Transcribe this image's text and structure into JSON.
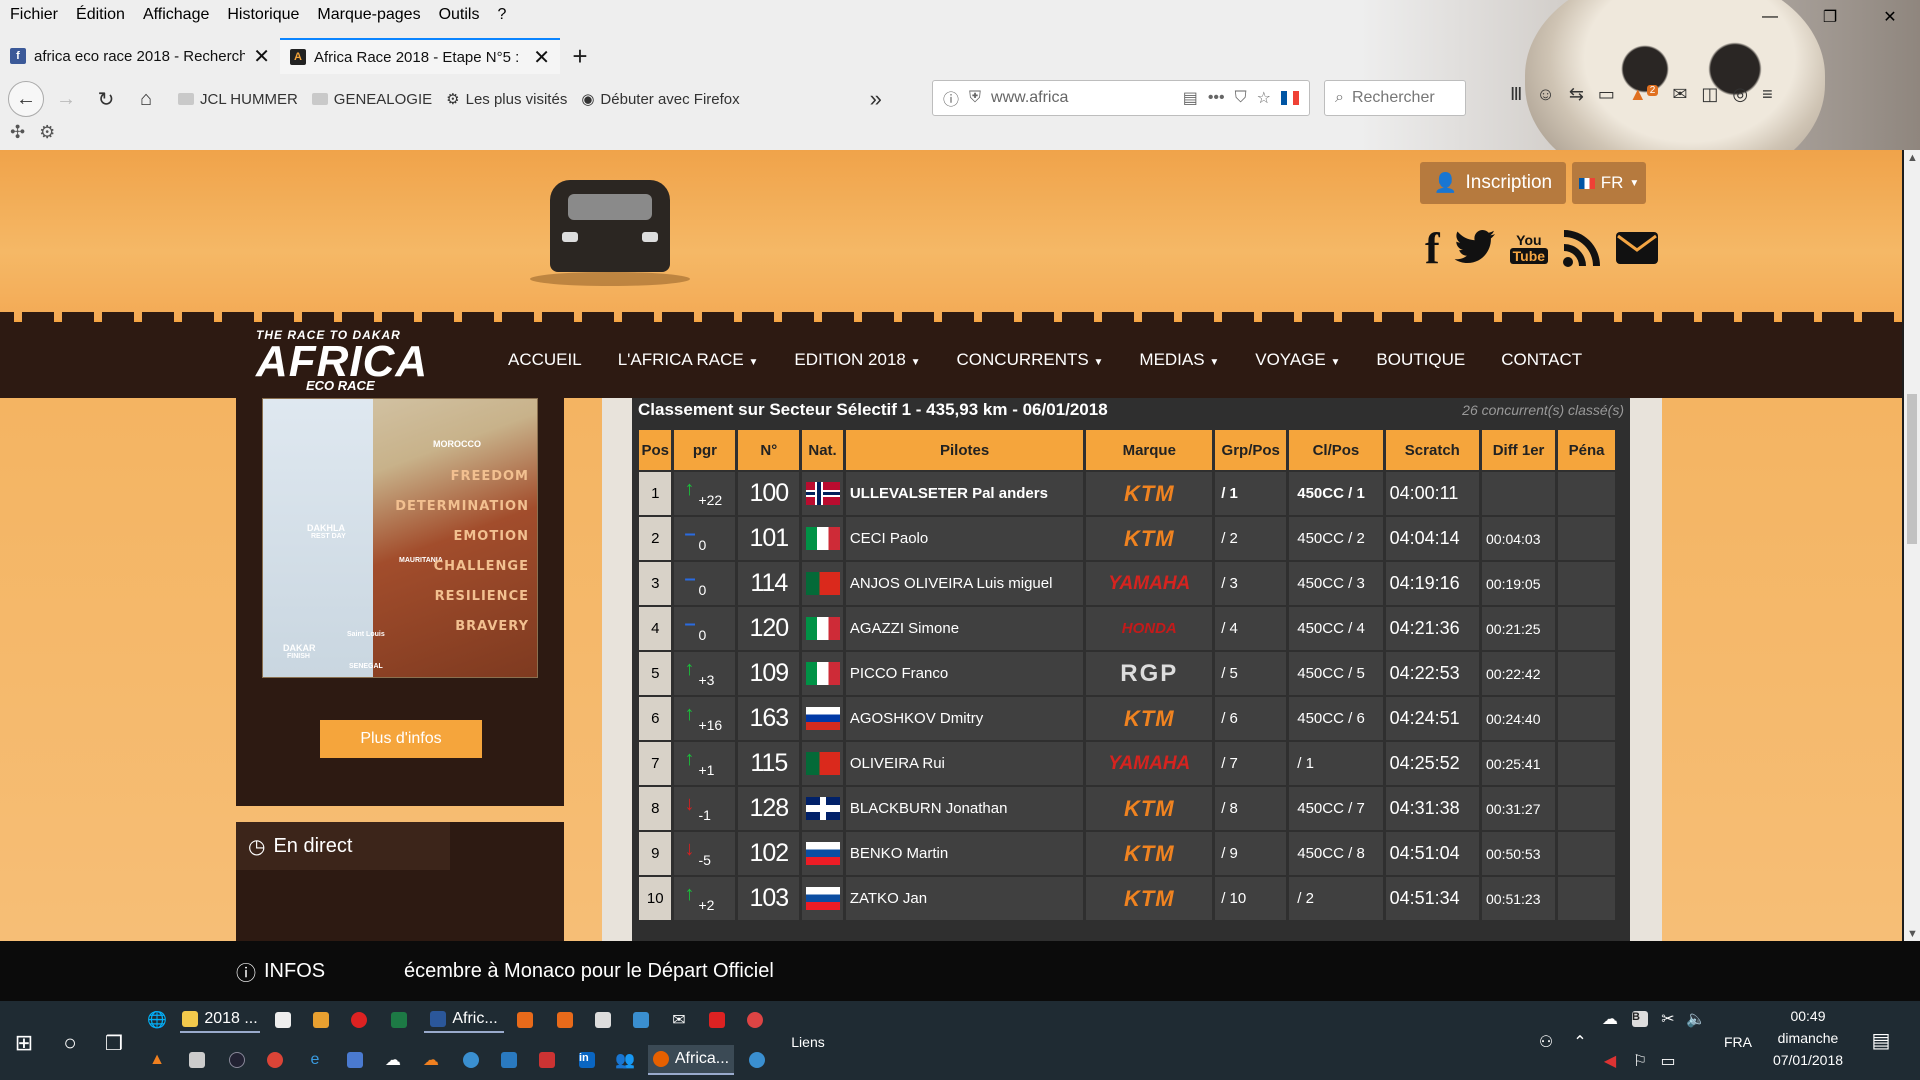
{
  "browser": {
    "menu": [
      "Fichier",
      "Édition",
      "Affichage",
      "Historique",
      "Marque-pages",
      "Outils",
      "?"
    ],
    "tabs": [
      {
        "title": "africa eco race 2018 - Recherch",
        "icon": "facebook-favicon"
      },
      {
        "title": "Africa Race 2018 - Etape N°5 : ",
        "icon": "africa-race-favicon"
      }
    ],
    "bookmarks": [
      "JCL HUMMER",
      "GENEALOGIE",
      "Les plus visités",
      "Débuter avec Firefox"
    ],
    "url": "www.africa",
    "search_placeholder": "Rechercher",
    "badge_count": "2"
  },
  "site": {
    "inscription": "Inscription",
    "lang": "FR",
    "logo": {
      "line1": "THE RACE TO DAKAR",
      "line2": "AFRICA",
      "line3": "ECO RACE"
    },
    "nav": [
      "ACCUEIL",
      "L'AFRICA RACE",
      "EDITION 2018",
      "CONCURRENTS",
      "MEDIAS",
      "VOYAGE",
      "BOUTIQUE",
      "CONTACT"
    ],
    "nav_dropdown": [
      false,
      true,
      true,
      true,
      true,
      true,
      false,
      false
    ],
    "map_words": [
      "FREEDOM",
      "DETERMINATION",
      "EMOTION",
      "CHALLENGE",
      "RESILIENCE",
      "BRAVERY"
    ],
    "map_labels": [
      "MOROCCO",
      "DAKHLA",
      "REST DAY",
      "MAURITANIA",
      "SENEGAL",
      "DAKAR",
      "FINISH",
      "Saint Louis"
    ],
    "plus_infos": "Plus d'infos",
    "en_direct": "En direct"
  },
  "classement": {
    "title": "Classement sur Secteur Sélectif 1 - 435,93 km - 06/01/2018",
    "count": "26 concurrent(s) classé(s)",
    "headers": [
      "Pos",
      "pgr",
      "N°",
      "Nat.",
      "Pilotes",
      "Marque",
      "Grp/Pos",
      "Cl/Pos",
      "Scratch",
      "Diff 1er",
      "Péna"
    ],
    "rows": [
      {
        "pos": "1",
        "dir": "up",
        "pgr": "+22",
        "num": "100",
        "nat": "NOR",
        "pilote": "ULLEVALSETER Pal anders",
        "marque": "KTM",
        "grp": "/ 1",
        "cl": "450CC / 1",
        "scratch": "04:00:11",
        "diff": "",
        "pena": ""
      },
      {
        "pos": "2",
        "dir": "eq",
        "pgr": "0",
        "num": "101",
        "nat": "ITA",
        "pilote": "CECI Paolo",
        "marque": "KTM",
        "grp": "/ 2",
        "cl": "450CC / 2",
        "scratch": "04:04:14",
        "diff": "00:04:03",
        "pena": ""
      },
      {
        "pos": "3",
        "dir": "eq",
        "pgr": "0",
        "num": "114",
        "nat": "POR",
        "pilote": "ANJOS OLIVEIRA Luis miguel",
        "marque": "YAMAHA",
        "grp": "/ 3",
        "cl": "450CC / 3",
        "scratch": "04:19:16",
        "diff": "00:19:05",
        "pena": ""
      },
      {
        "pos": "4",
        "dir": "eq",
        "pgr": "0",
        "num": "120",
        "nat": "ITA",
        "pilote": "AGAZZI Simone",
        "marque": "HONDA",
        "grp": "/ 4",
        "cl": "450CC / 4",
        "scratch": "04:21:36",
        "diff": "00:21:25",
        "pena": ""
      },
      {
        "pos": "5",
        "dir": "up",
        "pgr": "+3",
        "num": "109",
        "nat": "ITA",
        "pilote": "PICCO Franco",
        "marque": "RGP",
        "grp": "/ 5",
        "cl": "450CC / 5",
        "scratch": "04:22:53",
        "diff": "00:22:42",
        "pena": ""
      },
      {
        "pos": "6",
        "dir": "up",
        "pgr": "+16",
        "num": "163",
        "nat": "RUS",
        "pilote": "AGOSHKOV Dmitry",
        "marque": "KTM",
        "grp": "/ 6",
        "cl": "450CC / 6",
        "scratch": "04:24:51",
        "diff": "00:24:40",
        "pena": ""
      },
      {
        "pos": "7",
        "dir": "up",
        "pgr": "+1",
        "num": "115",
        "nat": "POR",
        "pilote": "OLIVEIRA Rui",
        "marque": "YAMAHA",
        "grp": "/ 7",
        "cl": "/ 1",
        "scratch": "04:25:52",
        "diff": "00:25:41",
        "pena": ""
      },
      {
        "pos": "8",
        "dir": "down",
        "pgr": "-1",
        "num": "128",
        "nat": "GBR",
        "pilote": "BLACKBURN Jonathan",
        "marque": "KTM",
        "grp": "/ 8",
        "cl": "450CC / 7",
        "scratch": "04:31:38",
        "diff": "00:31:27",
        "pena": ""
      },
      {
        "pos": "9",
        "dir": "down",
        "pgr": "-5",
        "num": "102",
        "nat": "SVK",
        "pilote": "BENKO Martin",
        "marque": "KTM",
        "grp": "/ 9",
        "cl": "450CC / 8",
        "scratch": "04:51:04",
        "diff": "00:50:53",
        "pena": ""
      },
      {
        "pos": "10",
        "dir": "up",
        "pgr": "+2",
        "num": "103",
        "nat": "SVK",
        "pilote": "ZATKO Jan",
        "marque": "KTM",
        "grp": "/ 10",
        "cl": "/ 2",
        "scratch": "04:51:34",
        "diff": "00:51:23",
        "pena": ""
      }
    ]
  },
  "infos": {
    "label": "INFOS",
    "ticker": "écembre à Monaco pour le Départ Officiel"
  },
  "taskbar": {
    "pinned1": "2018 ...",
    "pinned2": "Afric...",
    "pinned3": "Africa...",
    "liens": "Liens",
    "lang": "FRA",
    "time": "00:49",
    "day": "dimanche",
    "date": "07/01/2018"
  },
  "colors": {
    "accent": "#f5a53c",
    "dark": "#2d1a12",
    "up": "#19c23a",
    "down": "#d42020",
    "eq": "#2a6be0"
  }
}
